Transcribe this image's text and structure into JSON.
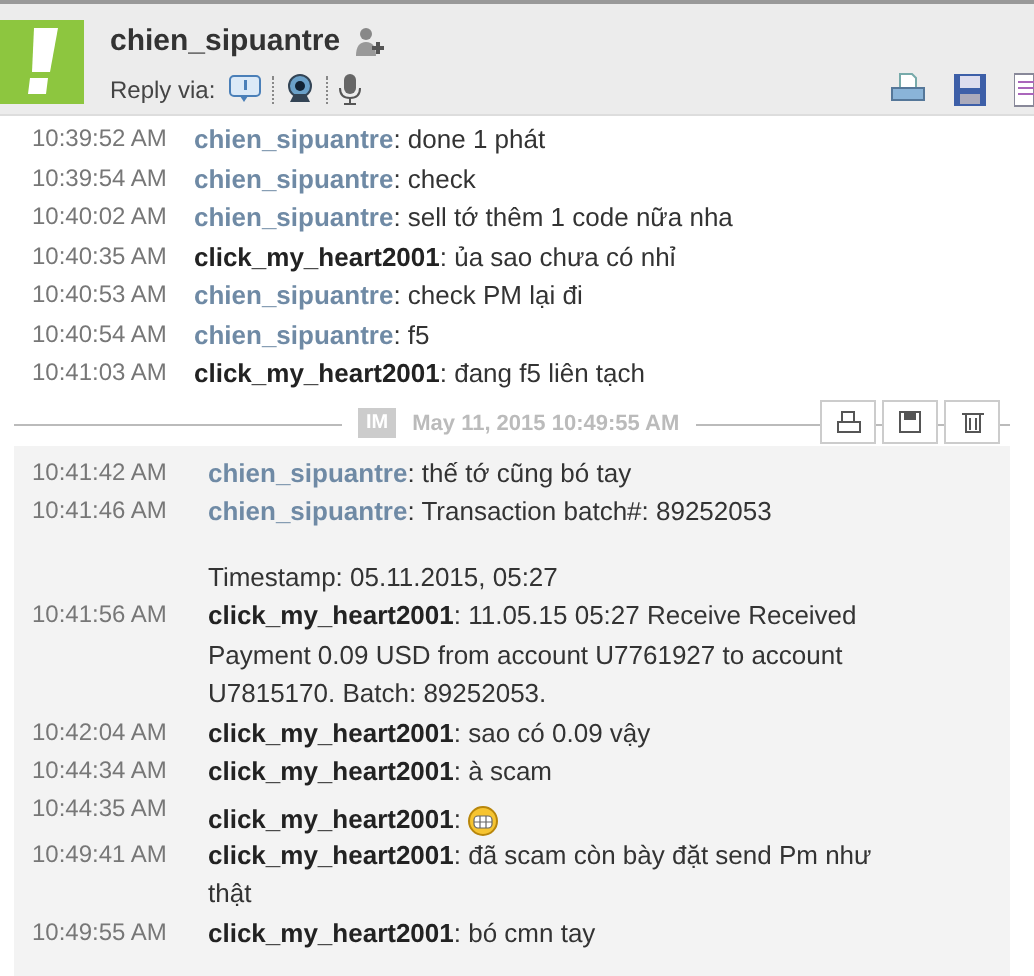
{
  "header": {
    "contact": "chien_sipuantre",
    "reply_label": "Reply via:"
  },
  "sessions": [
    {
      "messages": [
        {
          "time": "10:39:52 AM",
          "sender": "chien_sipuantre",
          "kind": "peer",
          "text": ": done 1 phát"
        },
        {
          "time": "10:39:54 AM",
          "sender": "chien_sipuantre",
          "kind": "peer",
          "text": ": check"
        },
        {
          "time": "10:40:02 AM",
          "sender": "chien_sipuantre",
          "kind": "peer",
          "text": ": sell tớ thêm 1 code nữa nha"
        },
        {
          "time": "10:40:35 AM",
          "sender": "click_my_heart2001",
          "kind": "self",
          "text": ": ủa sao chưa có nhỉ"
        },
        {
          "time": "10:40:53 AM",
          "sender": "chien_sipuantre",
          "kind": "peer",
          "text": ": check PM lại đi"
        },
        {
          "time": "10:40:54 AM",
          "sender": "chien_sipuantre",
          "kind": "peer",
          "text": ": f5"
        },
        {
          "time": "10:41:03 AM",
          "sender": "click_my_heart2001",
          "kind": "self",
          "text": ": đang f5 liên tạch"
        }
      ]
    },
    {
      "banner": {
        "tag": "IM",
        "date": "May 11, 2015 10:49:55 AM"
      },
      "messages": [
        {
          "time": "10:41:42 AM",
          "sender": "chien_sipuantre",
          "kind": "peer",
          "text": ": thế tớ cũng bó tay"
        },
        {
          "time": "10:41:46 AM",
          "sender": "chien_sipuantre",
          "kind": "peer",
          "text": ": Transaction batch#: 89252053",
          "extra": "Timestamp: 05.11.2015, 05:27"
        },
        {
          "time": "10:41:56 AM",
          "sender": "click_my_heart2001",
          "kind": "self",
          "text": ": 11.05.15 05:27 Receive Received Payment 0.09 USD from account U7761927 to account U7815170. Batch: 89252053."
        },
        {
          "time": "10:42:04 AM",
          "sender": "click_my_heart2001",
          "kind": "self",
          "text": ": sao có 0.09 vậy"
        },
        {
          "time": "10:44:34 AM",
          "sender": "click_my_heart2001",
          "kind": "self",
          "text": ": à scam"
        },
        {
          "time": "10:44:35 AM",
          "sender": "click_my_heart2001",
          "kind": "self",
          "text": ":",
          "emoticon": true
        },
        {
          "time": "10:49:41 AM",
          "sender": "click_my_heart2001",
          "kind": "self",
          "text": ": đã scam còn bày đặt send Pm như thật"
        },
        {
          "time": "10:49:55 AM",
          "sender": "click_my_heart2001",
          "kind": "self",
          "text": ": bó cmn tay"
        }
      ]
    }
  ]
}
